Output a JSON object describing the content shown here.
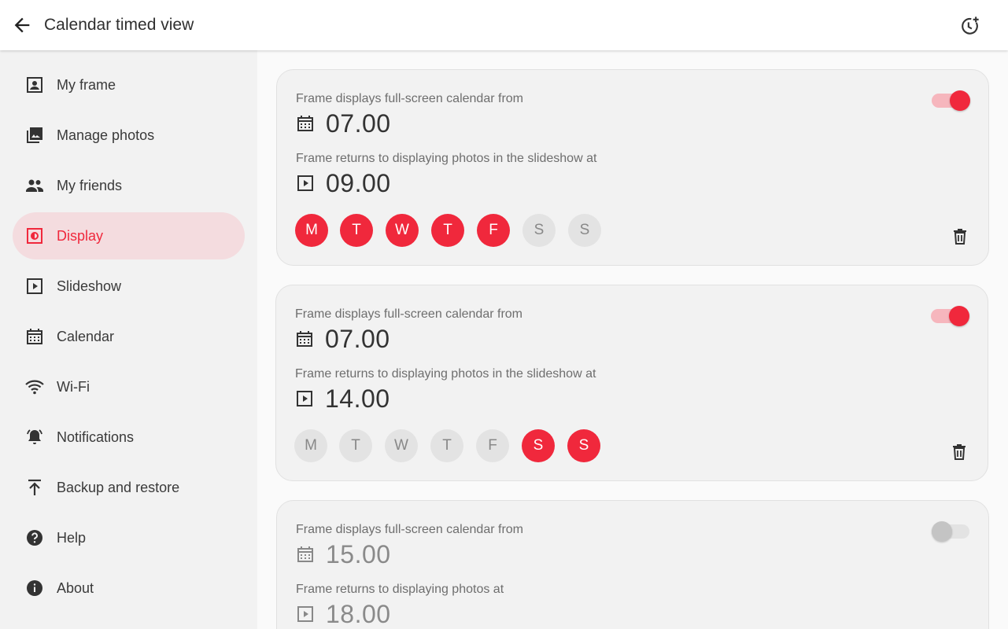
{
  "header": {
    "title": "Calendar timed view",
    "back_icon": "arrow-back-icon",
    "add_timer_icon": "add-timer-icon"
  },
  "sidebar": {
    "items": [
      {
        "label": "My frame",
        "icon": "portrait-icon"
      },
      {
        "label": "Manage photos",
        "icon": "photo-library-icon"
      },
      {
        "label": "My friends",
        "icon": "people-icon"
      },
      {
        "label": "Display",
        "icon": "display-icon",
        "active": true
      },
      {
        "label": "Slideshow",
        "icon": "slideshow-icon"
      },
      {
        "label": "Calendar",
        "icon": "calendar-icon"
      },
      {
        "label": "Wi-Fi",
        "icon": "wifi-icon"
      },
      {
        "label": "Notifications",
        "icon": "notifications-icon"
      },
      {
        "label": "Backup and restore",
        "icon": "upload-icon"
      },
      {
        "label": "Help",
        "icon": "help-icon"
      },
      {
        "label": "About",
        "icon": "info-icon"
      }
    ]
  },
  "schedules": [
    {
      "enabled": true,
      "from_label": "Frame displays full-screen calendar from",
      "from_time": "07.00",
      "to_label": "Frame returns to displaying photos in the slideshow at",
      "to_time": "09.00",
      "days": [
        {
          "label": "M",
          "on": true
        },
        {
          "label": "T",
          "on": true
        },
        {
          "label": "W",
          "on": true
        },
        {
          "label": "T",
          "on": true
        },
        {
          "label": "F",
          "on": true
        },
        {
          "label": "S",
          "on": false
        },
        {
          "label": "S",
          "on": false
        }
      ]
    },
    {
      "enabled": true,
      "from_label": "Frame displays full-screen calendar from",
      "from_time": "07.00",
      "to_label": "Frame returns to displaying photos in the slideshow at",
      "to_time": "14.00",
      "days": [
        {
          "label": "M",
          "on": false
        },
        {
          "label": "T",
          "on": false
        },
        {
          "label": "W",
          "on": false
        },
        {
          "label": "T",
          "on": false
        },
        {
          "label": "F",
          "on": false
        },
        {
          "label": "S",
          "on": true
        },
        {
          "label": "S",
          "on": true
        }
      ]
    },
    {
      "enabled": false,
      "from_label": "Frame displays full-screen calendar from",
      "from_time": "15.00",
      "to_label": "Frame returns to displaying photos at",
      "to_time": "18.00",
      "days": []
    }
  ],
  "colors": {
    "accent": "#f0283c",
    "accent_light": "#f6b6bd",
    "active_nav_bg": "#f4dcdf"
  }
}
